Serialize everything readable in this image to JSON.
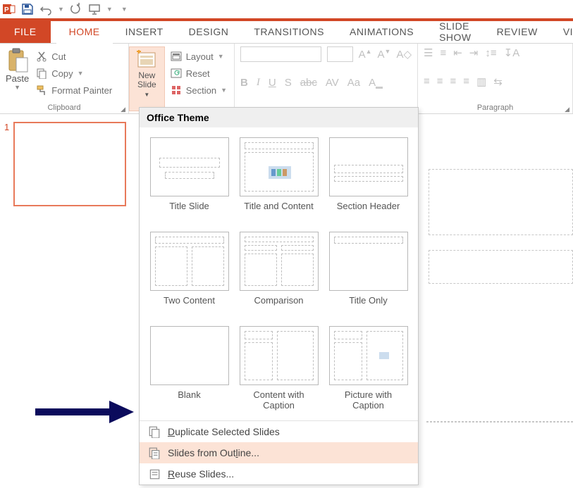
{
  "qat": {
    "app": "PowerPoint"
  },
  "tabs": {
    "file": "FILE",
    "list": [
      "HOME",
      "INSERT",
      "DESIGN",
      "TRANSITIONS",
      "ANIMATIONS",
      "SLIDE SHOW",
      "REVIEW",
      "VIEW"
    ],
    "active_index": 0
  },
  "ribbon": {
    "paste": "Paste",
    "cut": "Cut",
    "copy": "Copy",
    "format_painter": "Format Painter",
    "clipboard_group": "Clipboard",
    "new_slide": "New\nSlide",
    "layout": "Layout",
    "reset": "Reset",
    "section": "Section",
    "paragraph_group": "Paragraph"
  },
  "thumb": {
    "num": "1"
  },
  "dropdown": {
    "header": "Office Theme",
    "layouts": [
      "Title Slide",
      "Title and Content",
      "Section Header",
      "Two Content",
      "Comparison",
      "Title Only",
      "Blank",
      "Content with Caption",
      "Picture with Caption"
    ],
    "dup": "Duplicate Selected Slides",
    "outline": "Slides from Outline...",
    "reuse": "Reuse Slides..."
  }
}
